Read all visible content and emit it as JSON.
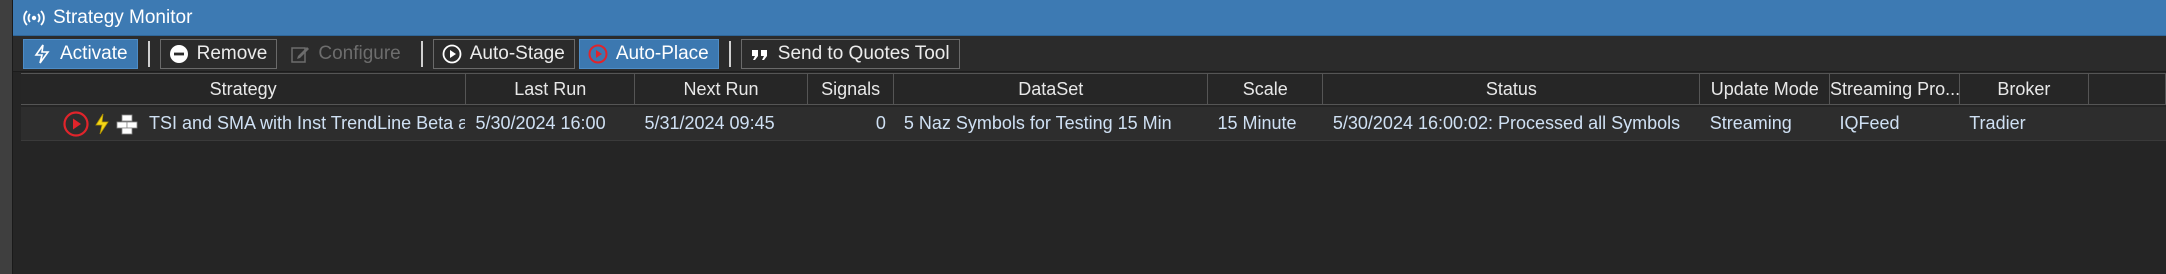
{
  "window": {
    "title": "Strategy Monitor",
    "title_icon": "broadcast-icon"
  },
  "toolbar": {
    "activate": "Activate",
    "remove": "Remove",
    "configure": "Configure",
    "auto_stage": "Auto-Stage",
    "auto_place": "Auto-Place",
    "send_to_quotes": "Send to Quotes Tool"
  },
  "grid": {
    "columns": [
      "Strategy",
      "Last Run",
      "Next Run",
      "Signals",
      "DataSet",
      "Scale",
      "Status",
      "Update Mode",
      "Streaming Pro...",
      "Broker"
    ],
    "rows": [
      {
        "strategy": "TSI and SMA with Inst TrendLine Beta ar",
        "last_run": "5/30/2024 16:00",
        "next_run": "5/31/2024 09:45",
        "signals": "0",
        "dataset": "5 Naz Symbols for Testing 15 Min",
        "scale": "15 Minute",
        "status": "5/30/2024 16:00:02: Processed all Symbols",
        "update_mode": "Streaming",
        "streaming_provider": "IQFeed",
        "broker": "Tradier",
        "icons": [
          "play-circle-icon",
          "lightning-icon",
          "stack-icon"
        ]
      }
    ]
  },
  "colors": {
    "title_bar": "#3d7ab3",
    "active_button": "#3c78b0",
    "background": "#252525",
    "cell_text": "#cfe0f3",
    "play_red": "#e0242b"
  }
}
